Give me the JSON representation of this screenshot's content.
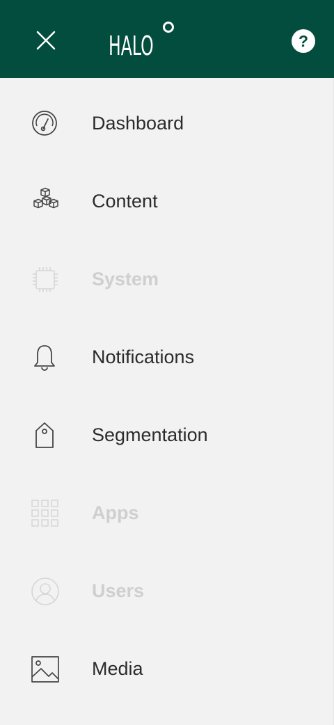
{
  "header": {
    "logo_text": "HALO",
    "help_label": "?"
  },
  "colors": {
    "header_bg": "#034d3e",
    "menu_bg": "#f2f2f2",
    "text_active": "#2b2b2b",
    "text_disabled": "#cfcfcf"
  },
  "nav": {
    "items": [
      {
        "label": "Dashboard",
        "icon": "gauge-icon",
        "enabled": true
      },
      {
        "label": "Content",
        "icon": "cubes-icon",
        "enabled": true
      },
      {
        "label": "System",
        "icon": "chip-icon",
        "enabled": false
      },
      {
        "label": "Notifications",
        "icon": "bell-icon",
        "enabled": true
      },
      {
        "label": "Segmentation",
        "icon": "tag-icon",
        "enabled": true
      },
      {
        "label": "Apps",
        "icon": "grid-icon",
        "enabled": false
      },
      {
        "label": "Users",
        "icon": "user-icon",
        "enabled": false
      },
      {
        "label": "Media",
        "icon": "image-icon",
        "enabled": true
      }
    ]
  }
}
